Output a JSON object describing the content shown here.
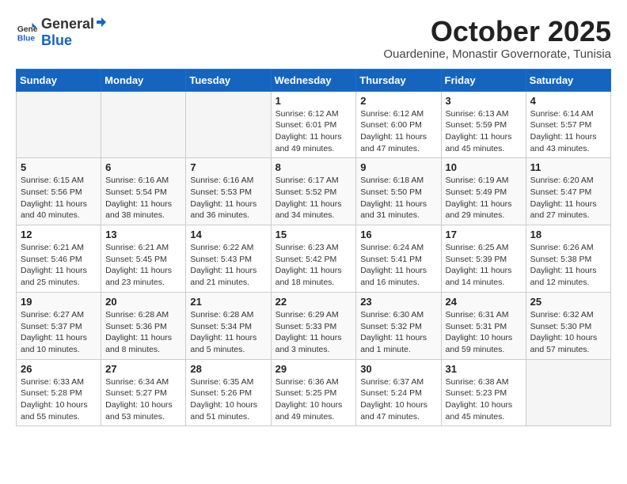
{
  "logo": {
    "general": "General",
    "blue": "Blue"
  },
  "header": {
    "month": "October 2025",
    "location": "Ouardenine, Monastir Governorate, Tunisia"
  },
  "weekdays": [
    "Sunday",
    "Monday",
    "Tuesday",
    "Wednesday",
    "Thursday",
    "Friday",
    "Saturday"
  ],
  "weeks": [
    [
      {
        "day": "",
        "info": ""
      },
      {
        "day": "",
        "info": ""
      },
      {
        "day": "",
        "info": ""
      },
      {
        "day": "1",
        "info": "Sunrise: 6:12 AM\nSunset: 6:01 PM\nDaylight: 11 hours and 49 minutes."
      },
      {
        "day": "2",
        "info": "Sunrise: 6:12 AM\nSunset: 6:00 PM\nDaylight: 11 hours and 47 minutes."
      },
      {
        "day": "3",
        "info": "Sunrise: 6:13 AM\nSunset: 5:59 PM\nDaylight: 11 hours and 45 minutes."
      },
      {
        "day": "4",
        "info": "Sunrise: 6:14 AM\nSunset: 5:57 PM\nDaylight: 11 hours and 43 minutes."
      }
    ],
    [
      {
        "day": "5",
        "info": "Sunrise: 6:15 AM\nSunset: 5:56 PM\nDaylight: 11 hours and 40 minutes."
      },
      {
        "day": "6",
        "info": "Sunrise: 6:16 AM\nSunset: 5:54 PM\nDaylight: 11 hours and 38 minutes."
      },
      {
        "day": "7",
        "info": "Sunrise: 6:16 AM\nSunset: 5:53 PM\nDaylight: 11 hours and 36 minutes."
      },
      {
        "day": "8",
        "info": "Sunrise: 6:17 AM\nSunset: 5:52 PM\nDaylight: 11 hours and 34 minutes."
      },
      {
        "day": "9",
        "info": "Sunrise: 6:18 AM\nSunset: 5:50 PM\nDaylight: 11 hours and 31 minutes."
      },
      {
        "day": "10",
        "info": "Sunrise: 6:19 AM\nSunset: 5:49 PM\nDaylight: 11 hours and 29 minutes."
      },
      {
        "day": "11",
        "info": "Sunrise: 6:20 AM\nSunset: 5:47 PM\nDaylight: 11 hours and 27 minutes."
      }
    ],
    [
      {
        "day": "12",
        "info": "Sunrise: 6:21 AM\nSunset: 5:46 PM\nDaylight: 11 hours and 25 minutes."
      },
      {
        "day": "13",
        "info": "Sunrise: 6:21 AM\nSunset: 5:45 PM\nDaylight: 11 hours and 23 minutes."
      },
      {
        "day": "14",
        "info": "Sunrise: 6:22 AM\nSunset: 5:43 PM\nDaylight: 11 hours and 21 minutes."
      },
      {
        "day": "15",
        "info": "Sunrise: 6:23 AM\nSunset: 5:42 PM\nDaylight: 11 hours and 18 minutes."
      },
      {
        "day": "16",
        "info": "Sunrise: 6:24 AM\nSunset: 5:41 PM\nDaylight: 11 hours and 16 minutes."
      },
      {
        "day": "17",
        "info": "Sunrise: 6:25 AM\nSunset: 5:39 PM\nDaylight: 11 hours and 14 minutes."
      },
      {
        "day": "18",
        "info": "Sunrise: 6:26 AM\nSunset: 5:38 PM\nDaylight: 11 hours and 12 minutes."
      }
    ],
    [
      {
        "day": "19",
        "info": "Sunrise: 6:27 AM\nSunset: 5:37 PM\nDaylight: 11 hours and 10 minutes."
      },
      {
        "day": "20",
        "info": "Sunrise: 6:28 AM\nSunset: 5:36 PM\nDaylight: 11 hours and 8 minutes."
      },
      {
        "day": "21",
        "info": "Sunrise: 6:28 AM\nSunset: 5:34 PM\nDaylight: 11 hours and 5 minutes."
      },
      {
        "day": "22",
        "info": "Sunrise: 6:29 AM\nSunset: 5:33 PM\nDaylight: 11 hours and 3 minutes."
      },
      {
        "day": "23",
        "info": "Sunrise: 6:30 AM\nSunset: 5:32 PM\nDaylight: 11 hours and 1 minute."
      },
      {
        "day": "24",
        "info": "Sunrise: 6:31 AM\nSunset: 5:31 PM\nDaylight: 10 hours and 59 minutes."
      },
      {
        "day": "25",
        "info": "Sunrise: 6:32 AM\nSunset: 5:30 PM\nDaylight: 10 hours and 57 minutes."
      }
    ],
    [
      {
        "day": "26",
        "info": "Sunrise: 6:33 AM\nSunset: 5:28 PM\nDaylight: 10 hours and 55 minutes."
      },
      {
        "day": "27",
        "info": "Sunrise: 6:34 AM\nSunset: 5:27 PM\nDaylight: 10 hours and 53 minutes."
      },
      {
        "day": "28",
        "info": "Sunrise: 6:35 AM\nSunset: 5:26 PM\nDaylight: 10 hours and 51 minutes."
      },
      {
        "day": "29",
        "info": "Sunrise: 6:36 AM\nSunset: 5:25 PM\nDaylight: 10 hours and 49 minutes."
      },
      {
        "day": "30",
        "info": "Sunrise: 6:37 AM\nSunset: 5:24 PM\nDaylight: 10 hours and 47 minutes."
      },
      {
        "day": "31",
        "info": "Sunrise: 6:38 AM\nSunset: 5:23 PM\nDaylight: 10 hours and 45 minutes."
      },
      {
        "day": "",
        "info": ""
      }
    ]
  ]
}
